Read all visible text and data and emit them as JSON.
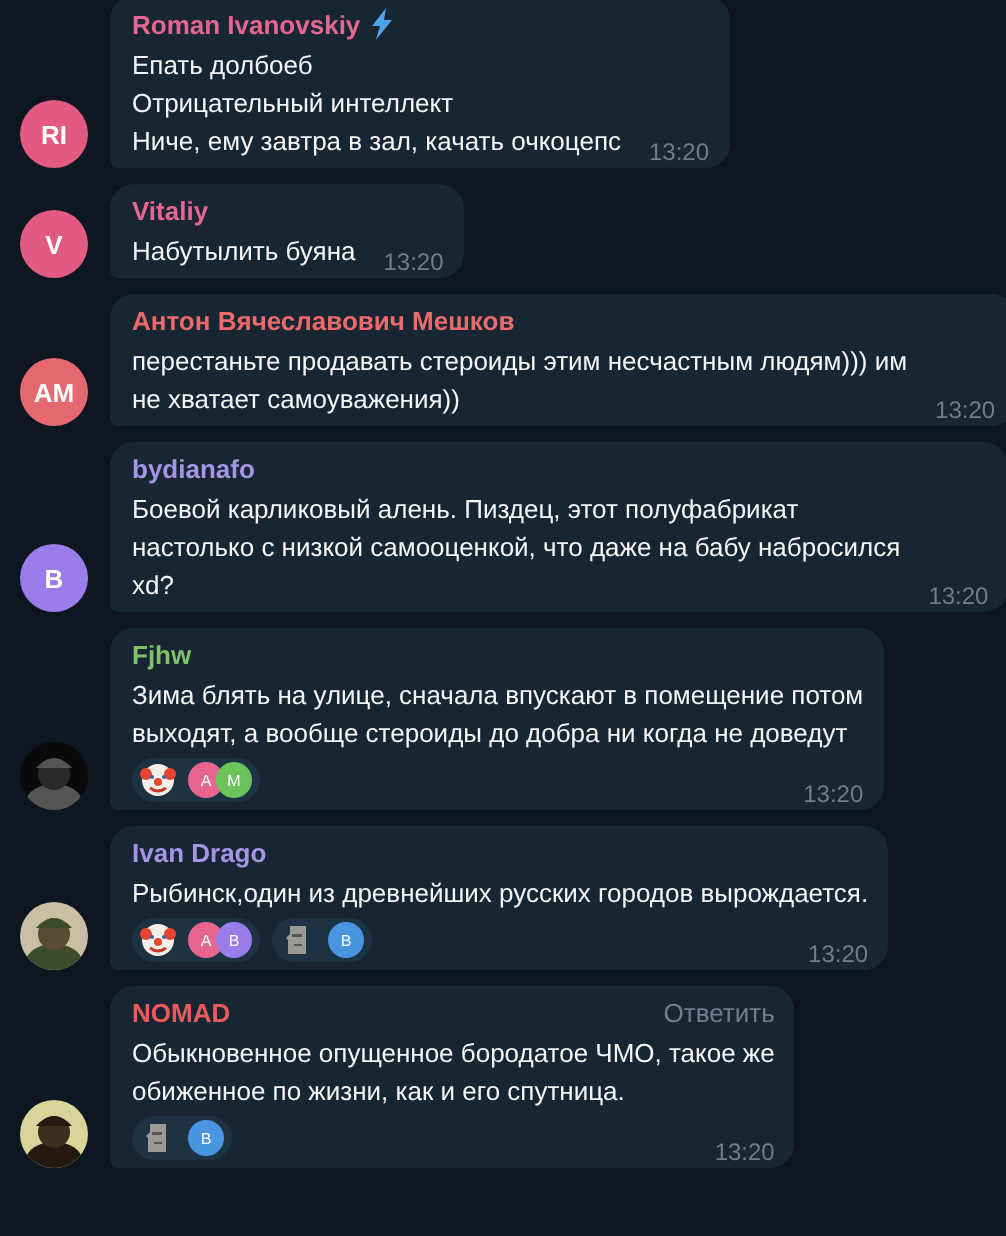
{
  "messages": [
    {
      "author": "Roman Ivanovskiy",
      "color": "#e5678f",
      "premium": true,
      "avatar": {
        "kind": "initials",
        "text": "RI",
        "color": "#e25a82"
      },
      "text": "Епать долбоеб\nОтрицательный интеллект\nНиче, ему завтра в зал, качать очкоцепс",
      "time": "13:20"
    },
    {
      "author": "Vitaliy",
      "color": "#e5678f",
      "premium": false,
      "avatar": {
        "kind": "initials",
        "text": "V",
        "color": "#e25a82"
      },
      "text": "Набутылить буяна",
      "time": "13:20"
    },
    {
      "author": "Антон Вячеславович Мешков",
      "color": "#ec6a6a",
      "premium": false,
      "avatar": {
        "kind": "initials",
        "text": "AM",
        "color": "#e4686f"
      },
      "text": "перестаньте продавать стероиды этим несчастным людям))) им\nне хватает самоуважения))",
      "time": "13:20"
    },
    {
      "author": "bydianafo",
      "color": "#a695e7",
      "premium": false,
      "avatar": {
        "kind": "initials",
        "text": "B",
        "color": "#9a7de8"
      },
      "text": "Боевой карликовый алень. Пиздец, этот полуфабрикат\nнастолько с низкой самооценкой, что даже на бабу набросился\nxd?",
      "time": "13:20"
    },
    {
      "author": "Fjhw",
      "color": "#7fc26a",
      "premium": false,
      "avatar": {
        "kind": "picture"
      },
      "text": "Зима блять на улице, сначала впускают в помещение потом\nвыходят, а вообще стероиды до добра ни когда не доведут",
      "time": "13:20",
      "reactions": [
        {
          "kind": "clown",
          "users": [
            {
              "initial": "A",
              "color": "#e5678f"
            },
            {
              "initial": "M",
              "color": "#6cc35c"
            }
          ]
        }
      ]
    },
    {
      "author": "Ivan Drago",
      "color": "#a695e7",
      "premium": false,
      "avatar": {
        "kind": "picture"
      },
      "text": "Рыбинск,один из древнейших русских городов вырождается.",
      "time": "13:20",
      "reactions": [
        {
          "kind": "clown",
          "users": [
            {
              "initial": "A",
              "color": "#e5678f"
            },
            {
              "initial": "B",
              "color": "#9a7de8"
            }
          ]
        },
        {
          "kind": "moai",
          "users": [
            {
              "initial": "B",
              "color": "#4a95e0"
            }
          ]
        }
      ]
    },
    {
      "author": "NOMAD",
      "color": "#ec5b5b",
      "premium": false,
      "reply": "Ответить",
      "avatar": {
        "kind": "picture"
      },
      "text": "Обыкновенное опущенное бородатое ЧМО, такое же\nобиженное по жизни, как и его спутница.",
      "time": "13:20",
      "reactions": [
        {
          "kind": "moai",
          "users": [
            {
              "initial": "B",
              "color": "#4a95e0"
            }
          ]
        }
      ]
    }
  ]
}
